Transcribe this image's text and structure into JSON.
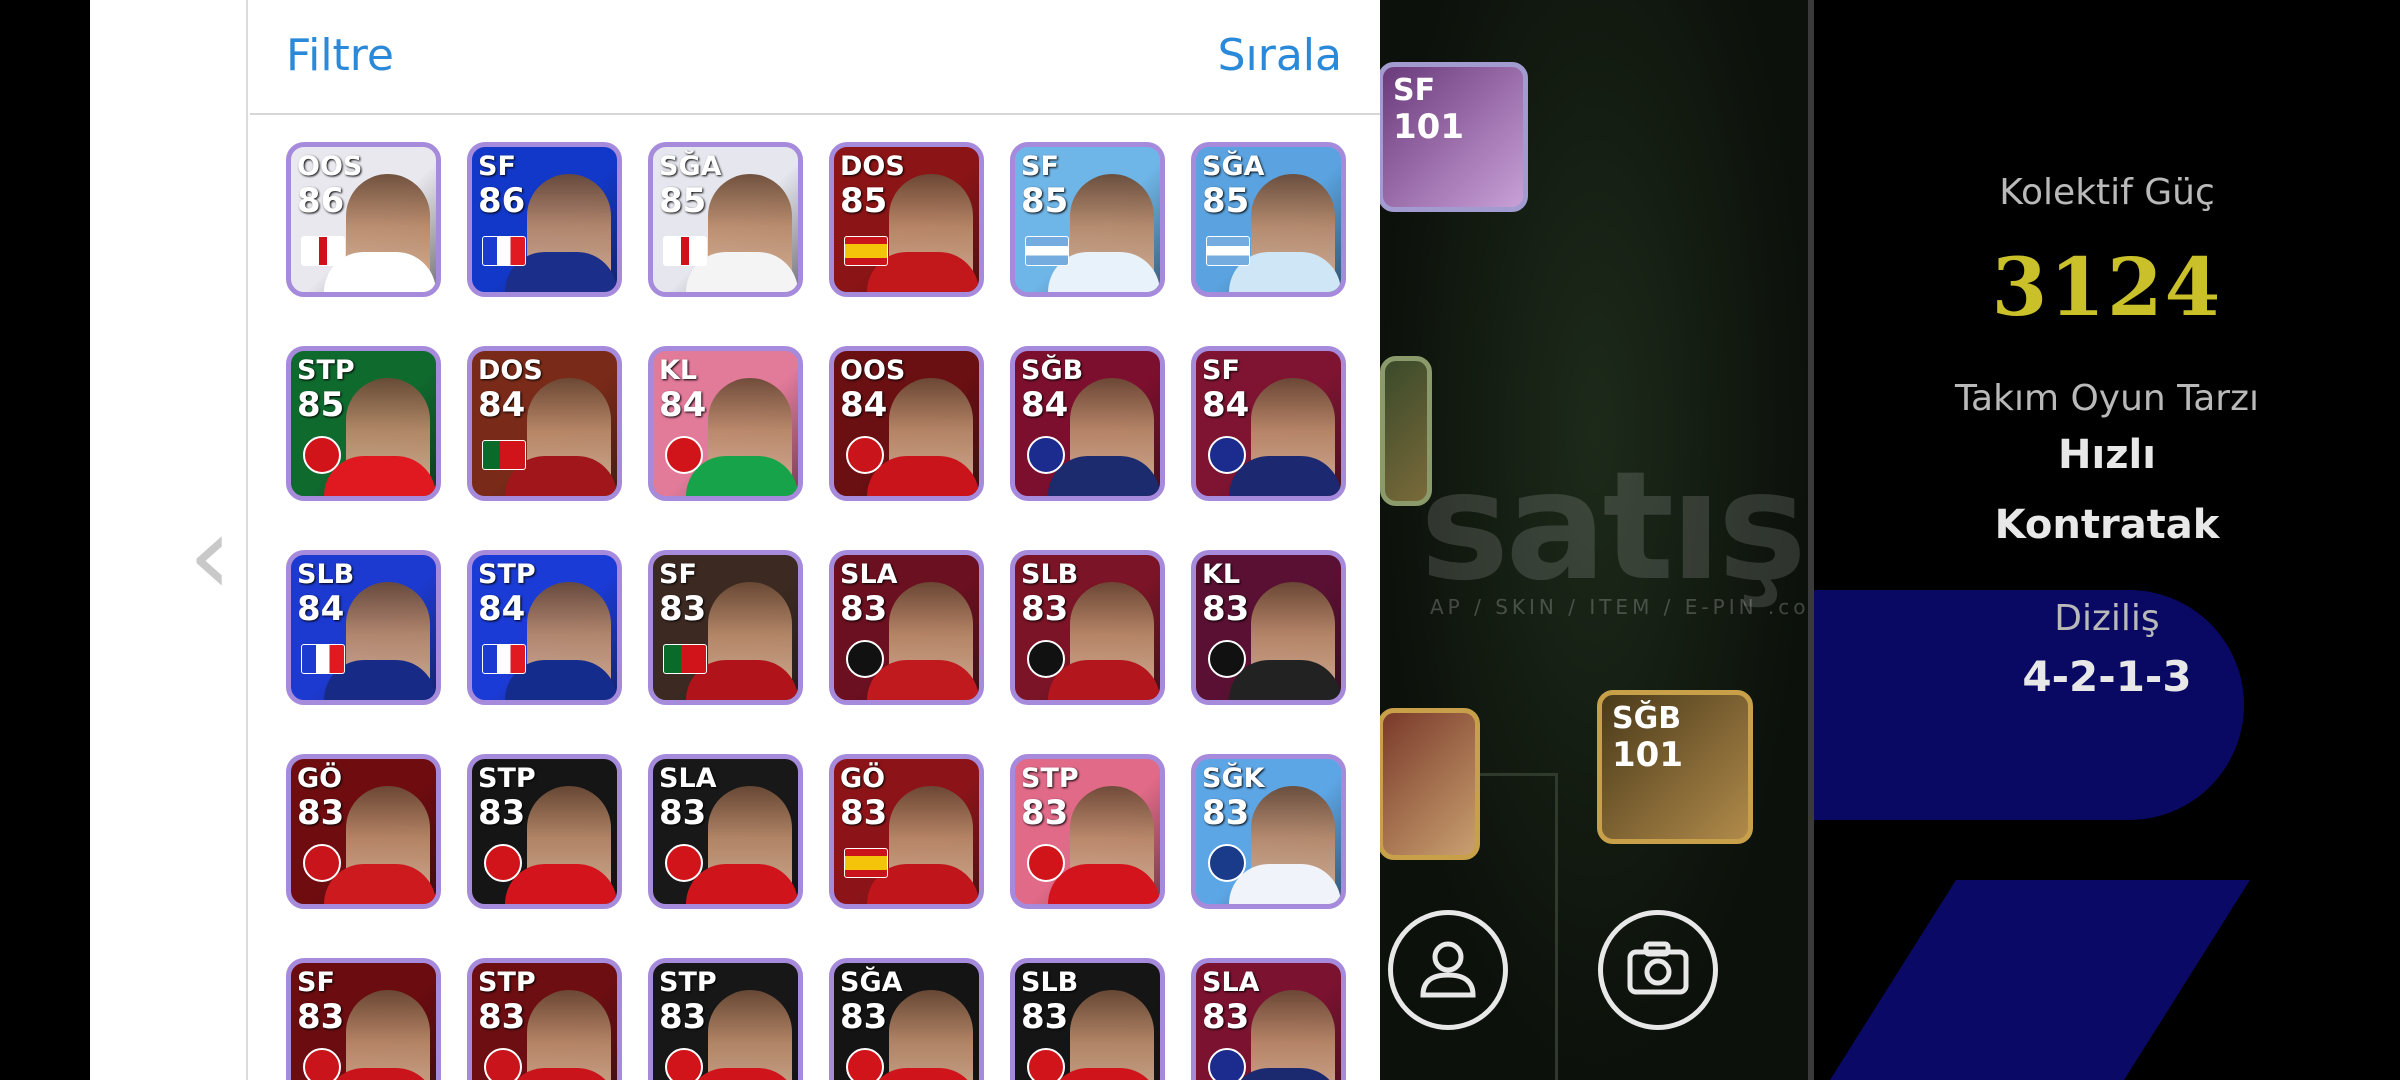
{
  "header": {
    "filter_label": "Filtre",
    "sort_label": "Sırala"
  },
  "info": {
    "power_label": "Kolektif Güç",
    "power_value": "3124",
    "style_label": "Takım Oyun Tarzı",
    "style_value_1": "Hızlı",
    "style_value_2": "Kontratak",
    "formation_label": "Diziliş",
    "formation_value": "4-2-1-3"
  },
  "watermark": {
    "main": "satış",
    "sub": "AP / SKIN / ITEM / E-PIN   .com"
  },
  "field_cards": [
    {
      "position": "SF",
      "rating": "101"
    },
    {
      "position": "SĞB",
      "rating": "101"
    }
  ],
  "players": [
    {
      "position": "OOS",
      "rating": "86",
      "bg": "#e8e8ee",
      "shirt": "#ffffff",
      "badge": "eng"
    },
    {
      "position": "SF",
      "rating": "86",
      "bg": "#1238c9",
      "shirt": "#1a2e8a",
      "badge": "fra"
    },
    {
      "position": "SĞA",
      "rating": "85",
      "bg": "#e6e6ee",
      "shirt": "#f4f4f4",
      "badge": "eng"
    },
    {
      "position": "DOS",
      "rating": "85",
      "bg": "#8a1416",
      "shirt": "#c2181c",
      "badge": "esp"
    },
    {
      "position": "SF",
      "rating": "85",
      "bg": "#6fb6e8",
      "shirt": "#e8f2fb",
      "badge": "arg"
    },
    {
      "position": "SĞA",
      "rating": "85",
      "bg": "#5aa3e0",
      "shirt": "#cfe6f7",
      "badge": "arg"
    },
    {
      "position": "STP",
      "rating": "85",
      "bg": "#0f6a2e",
      "shirt": "#e01820",
      "badge": "ars"
    },
    {
      "position": "DOS",
      "rating": "84",
      "bg": "#7a2a18",
      "shirt": "#a0161a",
      "badge": "por"
    },
    {
      "position": "KL",
      "rating": "84",
      "bg": "#e27a9a",
      "shirt": "#17a34a",
      "badge": "fcb"
    },
    {
      "position": "OOS",
      "rating": "84",
      "bg": "#6a0f12",
      "shirt": "#c8141a",
      "badge": "mun"
    },
    {
      "position": "SĞB",
      "rating": "84",
      "bg": "#7d0f2e",
      "shirt": "#1b2b6e",
      "badge": "bar"
    },
    {
      "position": "SF",
      "rating": "84",
      "bg": "#7e1432",
      "shirt": "#1c2870",
      "badge": "bar"
    },
    {
      "position": "SLB",
      "rating": "84",
      "bg": "#1c3ad0",
      "shirt": "#172b86",
      "badge": "fra"
    },
    {
      "position": "STP",
      "rating": "84",
      "bg": "#1b3bd6",
      "shirt": "#142c8c",
      "badge": "fra"
    },
    {
      "position": "SF",
      "rating": "83",
      "bg": "#3c2a22",
      "shirt": "#b0141a",
      "badge": "por"
    },
    {
      "position": "SLA",
      "rating": "83",
      "bg": "#6b1020",
      "shirt": "#c01a1f",
      "badge": "mil"
    },
    {
      "position": "SLB",
      "rating": "83",
      "bg": "#7a1426",
      "shirt": "#b3161c",
      "badge": "mil"
    },
    {
      "position": "KL",
      "rating": "83",
      "bg": "#5a1032",
      "shirt": "#222222",
      "badge": "mil"
    },
    {
      "position": "GÖ",
      "rating": "83",
      "bg": "#6e0c10",
      "shirt": "#cc1a1e",
      "badge": "mun"
    },
    {
      "position": "STP",
      "rating": "83",
      "bg": "#151515",
      "shirt": "#d3141c",
      "badge": "fcb"
    },
    {
      "position": "SLA",
      "rating": "83",
      "bg": "#181818",
      "shirt": "#d0141c",
      "badge": "fcb"
    },
    {
      "position": "GÖ",
      "rating": "83",
      "bg": "#8c1418",
      "shirt": "#c0161b",
      "badge": "esp"
    },
    {
      "position": "STP",
      "rating": "83",
      "bg": "#e06a88",
      "shirt": "#d3141c",
      "badge": "fcb"
    },
    {
      "position": "SĞK",
      "rating": "83",
      "bg": "#5da6e6",
      "shirt": "#f0f4fa",
      "badge": "club"
    },
    {
      "position": "SF",
      "rating": "83",
      "bg": "#6a0c10",
      "shirt": "#c8141a",
      "badge": "mun"
    },
    {
      "position": "STP",
      "rating": "83",
      "bg": "#6c0e12",
      "shirt": "#c8141a",
      "badge": "mun"
    },
    {
      "position": "STP",
      "rating": "83",
      "bg": "#171717",
      "shirt": "#d0141c",
      "badge": "fcb"
    },
    {
      "position": "SĞA",
      "rating": "83",
      "bg": "#141414",
      "shirt": "#d0141c",
      "badge": "fcb"
    },
    {
      "position": "SLB",
      "rating": "83",
      "bg": "#151515",
      "shirt": "#d0141c",
      "badge": "fcb"
    },
    {
      "position": "SLA",
      "rating": "83",
      "bg": "#7a1230",
      "shirt": "#1b2a6e",
      "badge": "bar"
    }
  ],
  "colors": {
    "accent": "#2b89d9",
    "power": "#c9c02a",
    "card_border": "#a68bdc"
  },
  "icons": {
    "back": "chevron-left-icon",
    "profile": "person-icon",
    "camera": "camera-icon"
  }
}
